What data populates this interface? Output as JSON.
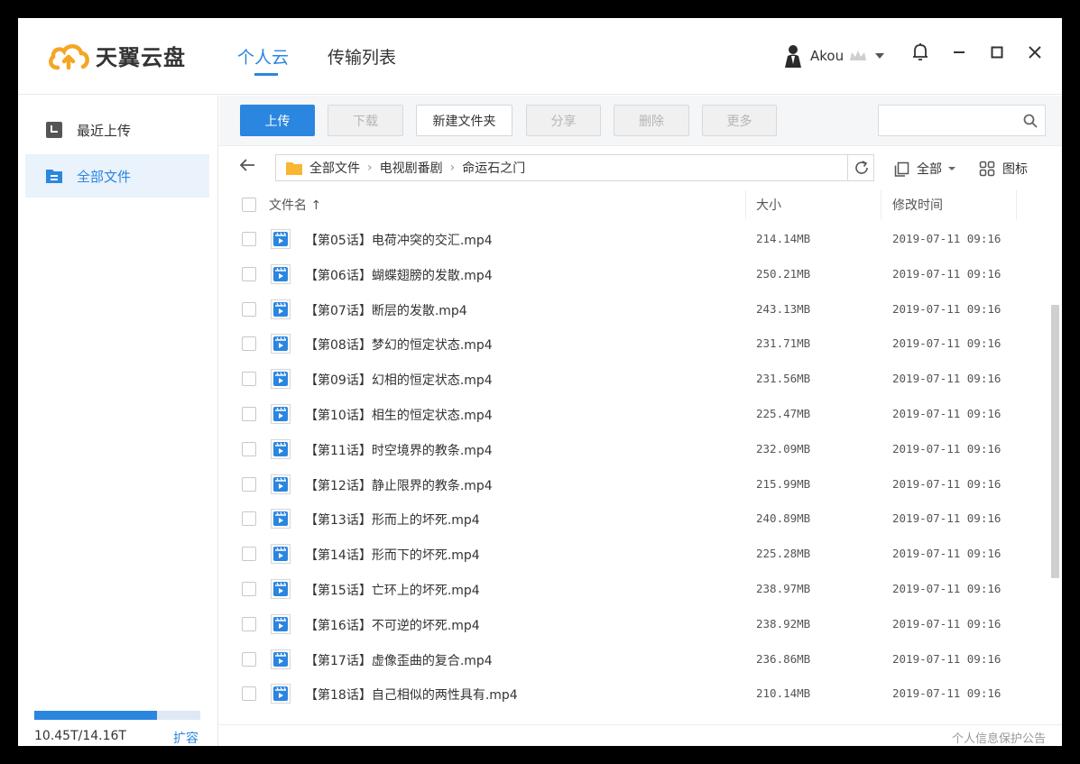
{
  "app": {
    "logo_text": "天翼云盘",
    "brand_color": "#2b86e0",
    "logo_color": "#f5a623"
  },
  "nav": {
    "tabs": [
      {
        "label": "个人云",
        "active": true
      },
      {
        "label": "传输列表",
        "active": false
      }
    ]
  },
  "user": {
    "name": "Akou",
    "avatar_icon": "person-avatar-icon",
    "badge_icon": "crown-icon"
  },
  "window_controls": [
    "bell-icon",
    "minimize-icon",
    "maximize-icon",
    "close-icon"
  ],
  "sidebar": {
    "items": [
      {
        "label": "最近上传",
        "icon": "recent-icon",
        "active": false
      },
      {
        "label": "全部文件",
        "icon": "all-files-icon",
        "active": true
      }
    ],
    "quota": {
      "used_text": "10.45T/14.16T",
      "used_fraction": 0.738,
      "expand_label": "扩容"
    }
  },
  "toolbar": {
    "upload": "上传",
    "download": "下载",
    "new_folder": "新建文件夹",
    "share": "分享",
    "delete": "删除",
    "more": "更多",
    "search_placeholder": ""
  },
  "breadcrumb": {
    "items": [
      "全部文件",
      "电视剧番剧",
      "命运石之门"
    ],
    "filter_label": "全部",
    "view_label": "图标"
  },
  "table": {
    "columns": {
      "name": "文件名 ↑",
      "size": "大小",
      "modified": "修改时间"
    },
    "rows": [
      {
        "name": "【第05话】电荷冲突的交汇.mp4",
        "size": "214.14MB",
        "modified": "2019-07-11 09:16"
      },
      {
        "name": "【第06话】蝴蝶翅膀的发散.mp4",
        "size": "250.21MB",
        "modified": "2019-07-11 09:16"
      },
      {
        "name": "【第07话】断层的发散.mp4",
        "size": "243.13MB",
        "modified": "2019-07-11 09:16"
      },
      {
        "name": "【第08话】梦幻的恒定状态.mp4",
        "size": "231.71MB",
        "modified": "2019-07-11 09:16"
      },
      {
        "name": "【第09话】幻相的恒定状态.mp4",
        "size": "231.56MB",
        "modified": "2019-07-11 09:16"
      },
      {
        "name": "【第10话】相生的恒定状态.mp4",
        "size": "225.47MB",
        "modified": "2019-07-11 09:16"
      },
      {
        "name": "【第11话】时空境界的教条.mp4",
        "size": "232.09MB",
        "modified": "2019-07-11 09:16"
      },
      {
        "name": "【第12话】静止限界的教条.mp4",
        "size": "215.99MB",
        "modified": "2019-07-11 09:16"
      },
      {
        "name": "【第13话】形而上的坏死.mp4",
        "size": "240.89MB",
        "modified": "2019-07-11 09:16"
      },
      {
        "name": "【第14话】形而下的坏死.mp4",
        "size": "225.28MB",
        "modified": "2019-07-11 09:16"
      },
      {
        "name": "【第15话】亡环上的坏死.mp4",
        "size": "238.97MB",
        "modified": "2019-07-11 09:16"
      },
      {
        "name": "【第16话】不可逆的坏死.mp4",
        "size": "238.92MB",
        "modified": "2019-07-11 09:16"
      },
      {
        "name": "【第17话】虚像歪曲的复合.mp4",
        "size": "236.86MB",
        "modified": "2019-07-11 09:16"
      },
      {
        "name": "【第18话】自己相似的两性具有.mp4",
        "size": "210.14MB",
        "modified": "2019-07-11 09:16"
      }
    ]
  },
  "footer": {
    "privacy_notice": "个人信息保护公告"
  }
}
